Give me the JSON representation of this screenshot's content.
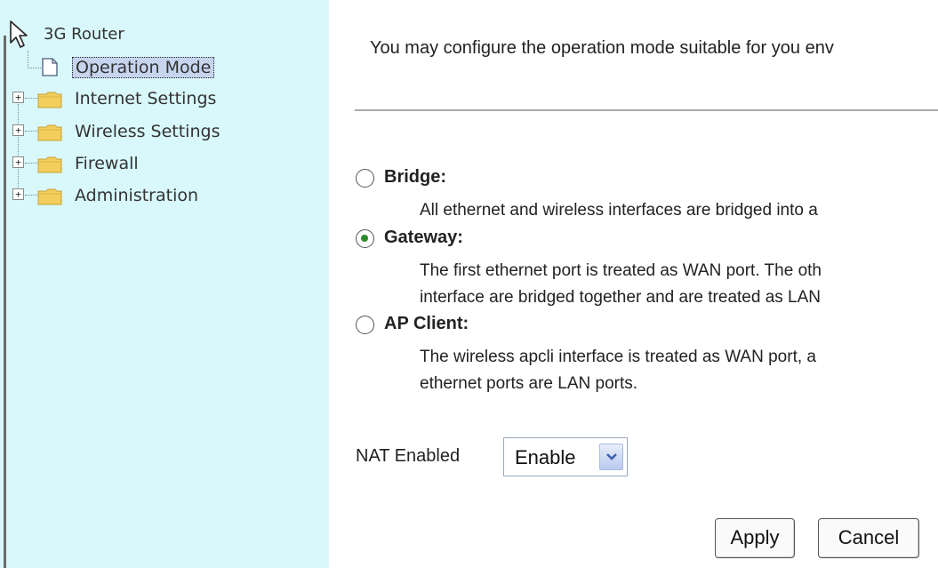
{
  "sidebar": {
    "root_label": "3G Router",
    "items": [
      {
        "label": "Operation Mode",
        "selected": true,
        "type": "page"
      },
      {
        "label": "Internet Settings",
        "type": "folder"
      },
      {
        "label": "Wireless Settings",
        "type": "folder"
      },
      {
        "label": "Firewall",
        "type": "folder"
      },
      {
        "label": "Administration",
        "type": "folder"
      }
    ],
    "expand_glyph": "+"
  },
  "main": {
    "intro": "You may configure the operation mode suitable for you env",
    "options": [
      {
        "title": "Bridge:",
        "checked": false,
        "desc": [
          "All ethernet and wireless interfaces are bridged into a"
        ]
      },
      {
        "title": "Gateway:",
        "checked": true,
        "desc": [
          "The first ethernet port is treated as WAN port. The oth",
          "interface are bridged together and are treated as LAN"
        ]
      },
      {
        "title": "AP Client:",
        "checked": false,
        "desc": [
          "The wireless apcli interface is treated as WAN port, a",
          "ethernet ports are LAN ports."
        ]
      }
    ],
    "nat": {
      "label": "NAT Enabled",
      "value": "Enable"
    },
    "buttons": {
      "apply": "Apply",
      "cancel": "Cancel"
    }
  },
  "colors": {
    "sidebar_bg": "#d9f8fb",
    "selection_bg": "#c6d4ee",
    "radio_dot": "#2e8b2e",
    "folder": "#f2cf5c"
  },
  "icons": [
    "mouse-cursor-icon",
    "router-icon",
    "page-icon",
    "folder-icon",
    "expand-plus-icon",
    "radio-icon",
    "dropdown-arrow-icon"
  ]
}
